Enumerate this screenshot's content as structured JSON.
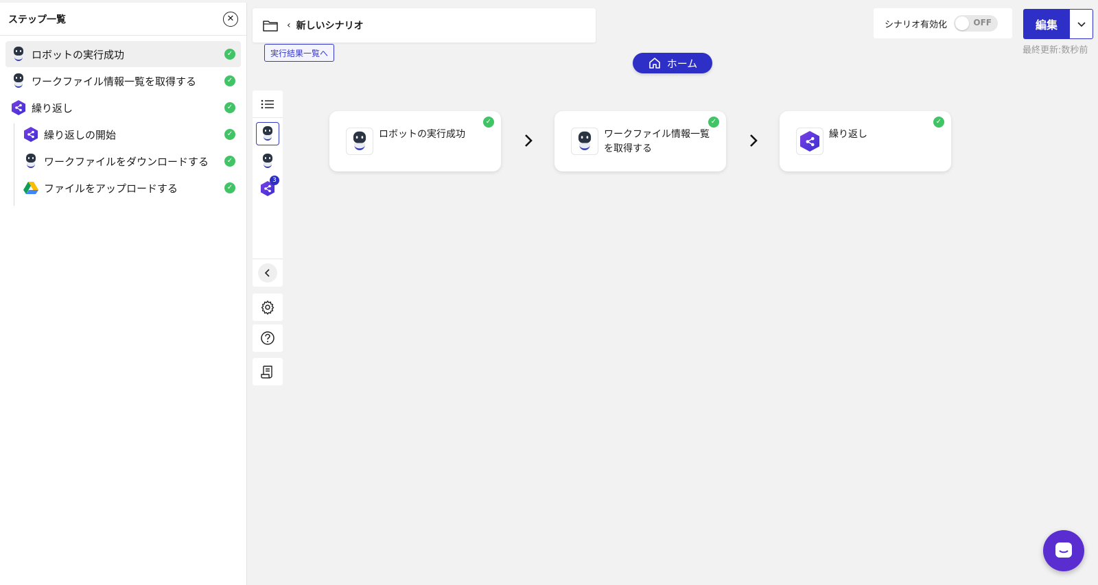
{
  "left_panel": {
    "title": "ステップ一覧",
    "items": [
      {
        "label": "ロボットの実行成功",
        "icon": "robot-icon"
      },
      {
        "label": "ワークファイル情報一覧を取得する",
        "icon": "robot-icon"
      },
      {
        "label": "繰り返し",
        "icon": "loop-icon"
      },
      {
        "label": "繰り返しの開始",
        "icon": "loop-icon"
      },
      {
        "label": "ワークファイルをダウンロードする",
        "icon": "robot-icon"
      },
      {
        "label": "ファイルをアップロードする",
        "icon": "google-drive-icon"
      }
    ]
  },
  "breadcrumb": {
    "label": "新しいシナリオ"
  },
  "results_link": "実行結果一覧へ",
  "home": {
    "label": "ホーム"
  },
  "toggle": {
    "label": "シナリオ有効化",
    "state": "OFF"
  },
  "edit_button": "編集",
  "last_updated": "最終更新:数秒前",
  "toolbar": {
    "badge": "3"
  },
  "flow": {
    "cards": [
      {
        "label": "ロボットの実行成功",
        "icon": "robot-icon"
      },
      {
        "label": "ワークファイル情報一覧を取得する",
        "icon": "robot-icon"
      },
      {
        "label": "繰り返し",
        "icon": "loop-icon"
      }
    ]
  },
  "colors": {
    "primary": "#2d2fc6",
    "success": "#41c466",
    "chat": "#5a2dd0"
  }
}
